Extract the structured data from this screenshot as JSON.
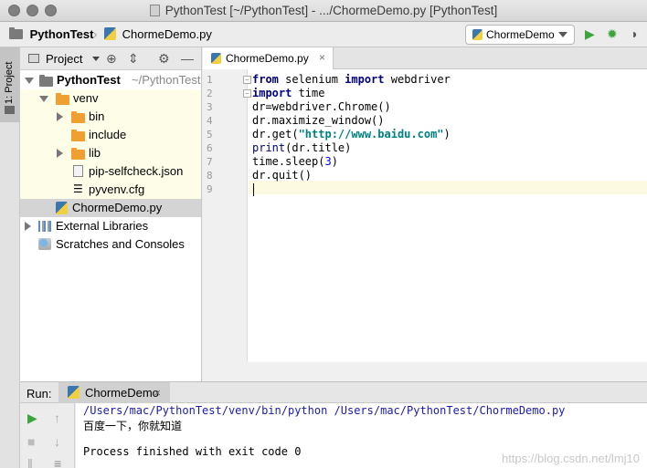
{
  "window": {
    "title": "PythonTest [~/PythonTest] - .../ChormeDemo.py [PythonTest]"
  },
  "navbar": {
    "project": "PythonTest",
    "file": "ChormeDemo.py",
    "run_config": "ChormeDemo"
  },
  "side_stripe": {
    "project_tab": "1: Project"
  },
  "project_panel": {
    "view_label": "Project",
    "tree": [
      {
        "label": "PythonTest",
        "hint": "~/PythonTest"
      },
      {
        "label": "venv"
      },
      {
        "label": "bin"
      },
      {
        "label": "include"
      },
      {
        "label": "lib"
      },
      {
        "label": "pip-selfcheck.json"
      },
      {
        "label": "pyvenv.cfg"
      },
      {
        "label": "ChormeDemo.py"
      },
      {
        "label": "External Libraries"
      },
      {
        "label": "Scratches and Consoles"
      }
    ]
  },
  "editor": {
    "tab_label": "ChormeDemo.py",
    "line_numbers": [
      "1",
      "2",
      "3",
      "4",
      "5",
      "6",
      "7",
      "8",
      "9"
    ],
    "code": [
      {
        "kw1": "from",
        "t1": " selenium ",
        "kw2": "import",
        "t2": " webdriver"
      },
      {
        "kw1": "import",
        "t1": " time"
      },
      {
        "t1": "dr=webdriver.Chrome()"
      },
      {
        "t1": "dr.maximize_window()"
      },
      {
        "t1": "dr.get(",
        "s": "\"http://www.baidu.com\"",
        "t2": ")"
      },
      {
        "b": "print",
        "t1": "(dr.title)"
      },
      {
        "t1": "time.sleep(",
        "n": "3",
        "t2": ")"
      },
      {
        "t1": "dr.quit()"
      },
      {
        "t1": ""
      }
    ]
  },
  "run_panel": {
    "label": "Run:",
    "tab_label": "ChormeDemo",
    "console": [
      "/Users/mac/PythonTest/venv/bin/python /Users/mac/PythonTest/ChormeDemo.py",
      "百度一下，你就知道",
      "",
      "Process finished with exit code 0"
    ],
    "watermark": "https://blog.csdn.net/lmj10"
  },
  "colors": {
    "keyword": "#000080",
    "string": "#008080",
    "console_path": "#1a1ab0",
    "run_green": "#3aa63a",
    "folder_orange": "#f0a030"
  }
}
